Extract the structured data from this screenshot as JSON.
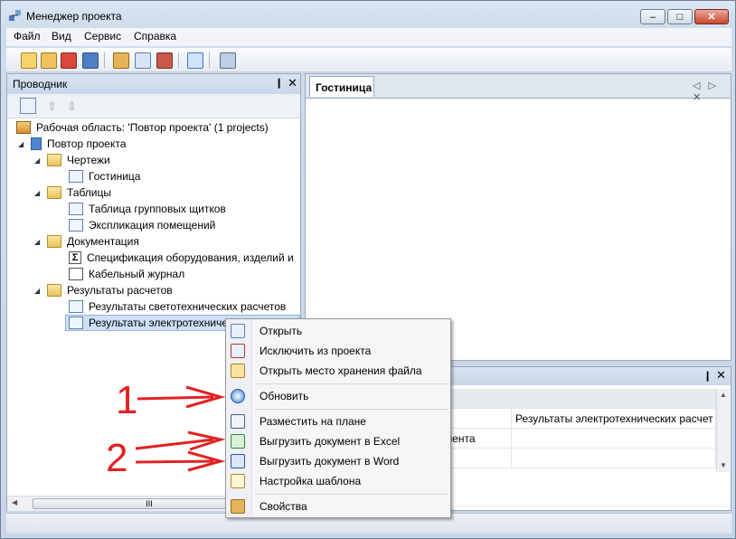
{
  "window": {
    "title": "Менеджер проекта"
  },
  "menu": {
    "items": [
      "Файл",
      "Вид",
      "Сервис",
      "Справка"
    ]
  },
  "explorer": {
    "title": "Проводник",
    "pin_glyph": "❙",
    "close_glyph": "✕",
    "tree": [
      {
        "label": "Рабочая область: 'Повтор проекта' (1 projects)"
      },
      {
        "label": "Повтор проекта"
      },
      {
        "label": "Чертежи"
      },
      {
        "label": "Гостиница"
      },
      {
        "label": "Таблицы"
      },
      {
        "label": "Таблица групповых щитков"
      },
      {
        "label": "Экспликация помещений"
      },
      {
        "label": "Документация"
      },
      {
        "label": "Спецификация оборудования, изделий и"
      },
      {
        "label": "Кабельный журнал"
      },
      {
        "label": "Результаты расчетов"
      },
      {
        "label": "Результаты светотехнических расчетов"
      },
      {
        "label": "Результаты электротехничес"
      }
    ],
    "sigma_glyph": "Σ",
    "scroll_grip": "III"
  },
  "document": {
    "tab_label": "Гостиница",
    "controls": "◁ ▷ ✕"
  },
  "properties": {
    "cells": {
      "value_header": "Результаты электротехнических расчет",
      "row1_name": "мента"
    }
  },
  "context_menu": {
    "items": [
      "Открыть",
      "Исключить из проекта",
      "Открыть место хранения файла",
      "Обновить",
      "Разместить на плане",
      "Выгрузить документ в Excel",
      "Выгрузить документ в Word",
      "Настройка шаблона",
      "Свойства"
    ]
  },
  "annotations": {
    "label_1": "1",
    "label_2": "2",
    "arrow_color": "#e22222"
  }
}
